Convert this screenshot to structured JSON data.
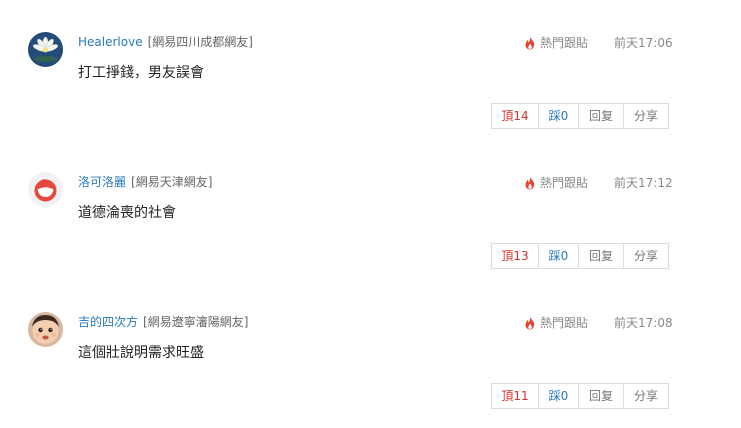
{
  "comments": [
    {
      "username": "Healerlove",
      "location": "[網易四川成都網友]",
      "hot_label": "熱門跟貼",
      "time": "前天17:06",
      "content": "打工掙錢，男友誤會",
      "avatar_icon": "lotus-avatar-icon",
      "actions": {
        "up": "頂14",
        "down": "踩0",
        "reply": "回复",
        "share": "分享"
      }
    },
    {
      "username": "洛可洛麗",
      "location": "[網易天津網友]",
      "hot_label": "熱門跟貼",
      "time": "前天17:12",
      "content": "道德淪喪的社會",
      "avatar_icon": "red-bowl-avatar-icon",
      "actions": {
        "up": "頂13",
        "down": "踩0",
        "reply": "回复",
        "share": "分享"
      }
    },
    {
      "username": "吉的四次方",
      "location": "[網易遼寧瀋陽網友]",
      "hot_label": "熱門跟貼",
      "time": "前天17:08",
      "content": "這個壯說明需求旺盛",
      "avatar_icon": "baby-avatar-icon",
      "actions": {
        "up": "頂11",
        "down": "踩0",
        "reply": "回复",
        "share": "分享"
      }
    }
  ],
  "colors": {
    "username": "#2a7ab8",
    "up_vote": "#d0332b",
    "down_vote": "#2a7ab8",
    "hot_fire": "#e8412c"
  }
}
